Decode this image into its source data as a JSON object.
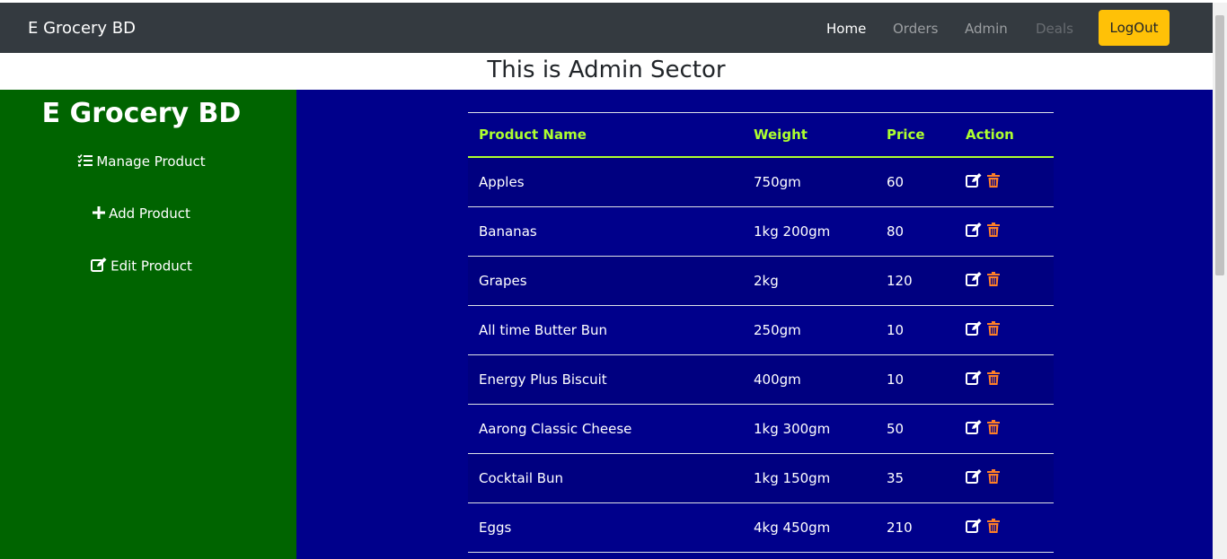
{
  "navbar": {
    "brand": "E Grocery BD",
    "links": [
      {
        "label": "Home",
        "state": "active"
      },
      {
        "label": "Orders",
        "state": "normal"
      },
      {
        "label": "Admin",
        "state": "normal"
      },
      {
        "label": "Deals",
        "state": "disabled"
      }
    ],
    "logout_label": "LogOut"
  },
  "page_title": "This is Admin Sector",
  "sidebar": {
    "brand": "E Grocery BD",
    "items": [
      {
        "label": "Manage Product",
        "icon": "tasks-icon"
      },
      {
        "label": "Add Product",
        "icon": "plus-icon"
      },
      {
        "label": "Edit Product",
        "icon": "edit-icon"
      }
    ]
  },
  "table": {
    "headers": [
      "Product Name",
      "Weight",
      "Price",
      "Action"
    ],
    "rows": [
      {
        "name": "Apples",
        "weight": "750gm",
        "price": "60"
      },
      {
        "name": "Bananas",
        "weight": "1kg 200gm",
        "price": "80"
      },
      {
        "name": "Grapes",
        "weight": "2kg",
        "price": "120"
      },
      {
        "name": "All time Butter Bun",
        "weight": "250gm",
        "price": "10"
      },
      {
        "name": "Energy Plus Biscuit",
        "weight": "400gm",
        "price": "10"
      },
      {
        "name": "Aarong Classic Cheese",
        "weight": "1kg 300gm",
        "price": "50"
      },
      {
        "name": "Cocktail Bun",
        "weight": "1kg 150gm",
        "price": "35"
      },
      {
        "name": "Eggs",
        "weight": "4kg 450gm",
        "price": "210"
      }
    ],
    "edit_icon": "edit-icon",
    "delete_icon": "trash-icon"
  },
  "colors": {
    "navbar_bg": "#343a40",
    "sidebar_bg": "#006400",
    "main_bg": "#00008b",
    "header_text": "#adff2f",
    "logout_bg": "#ffc107",
    "delete_icon": "#ff7f27"
  }
}
